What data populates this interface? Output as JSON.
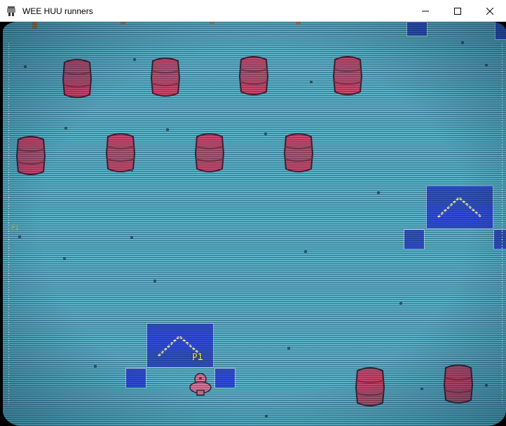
{
  "window": {
    "title": "WEE HUU runners",
    "icon": "app-icon",
    "controls": [
      "minimize-icon",
      "maximize-icon",
      "close-icon"
    ]
  },
  "hud": {
    "player_tag": "P1",
    "side_marker": "P1"
  },
  "colors": {
    "playfield": "#5ab0c8",
    "barrel": "#d23a5e",
    "block": "#2a3ed0",
    "label": "#e8d838"
  }
}
